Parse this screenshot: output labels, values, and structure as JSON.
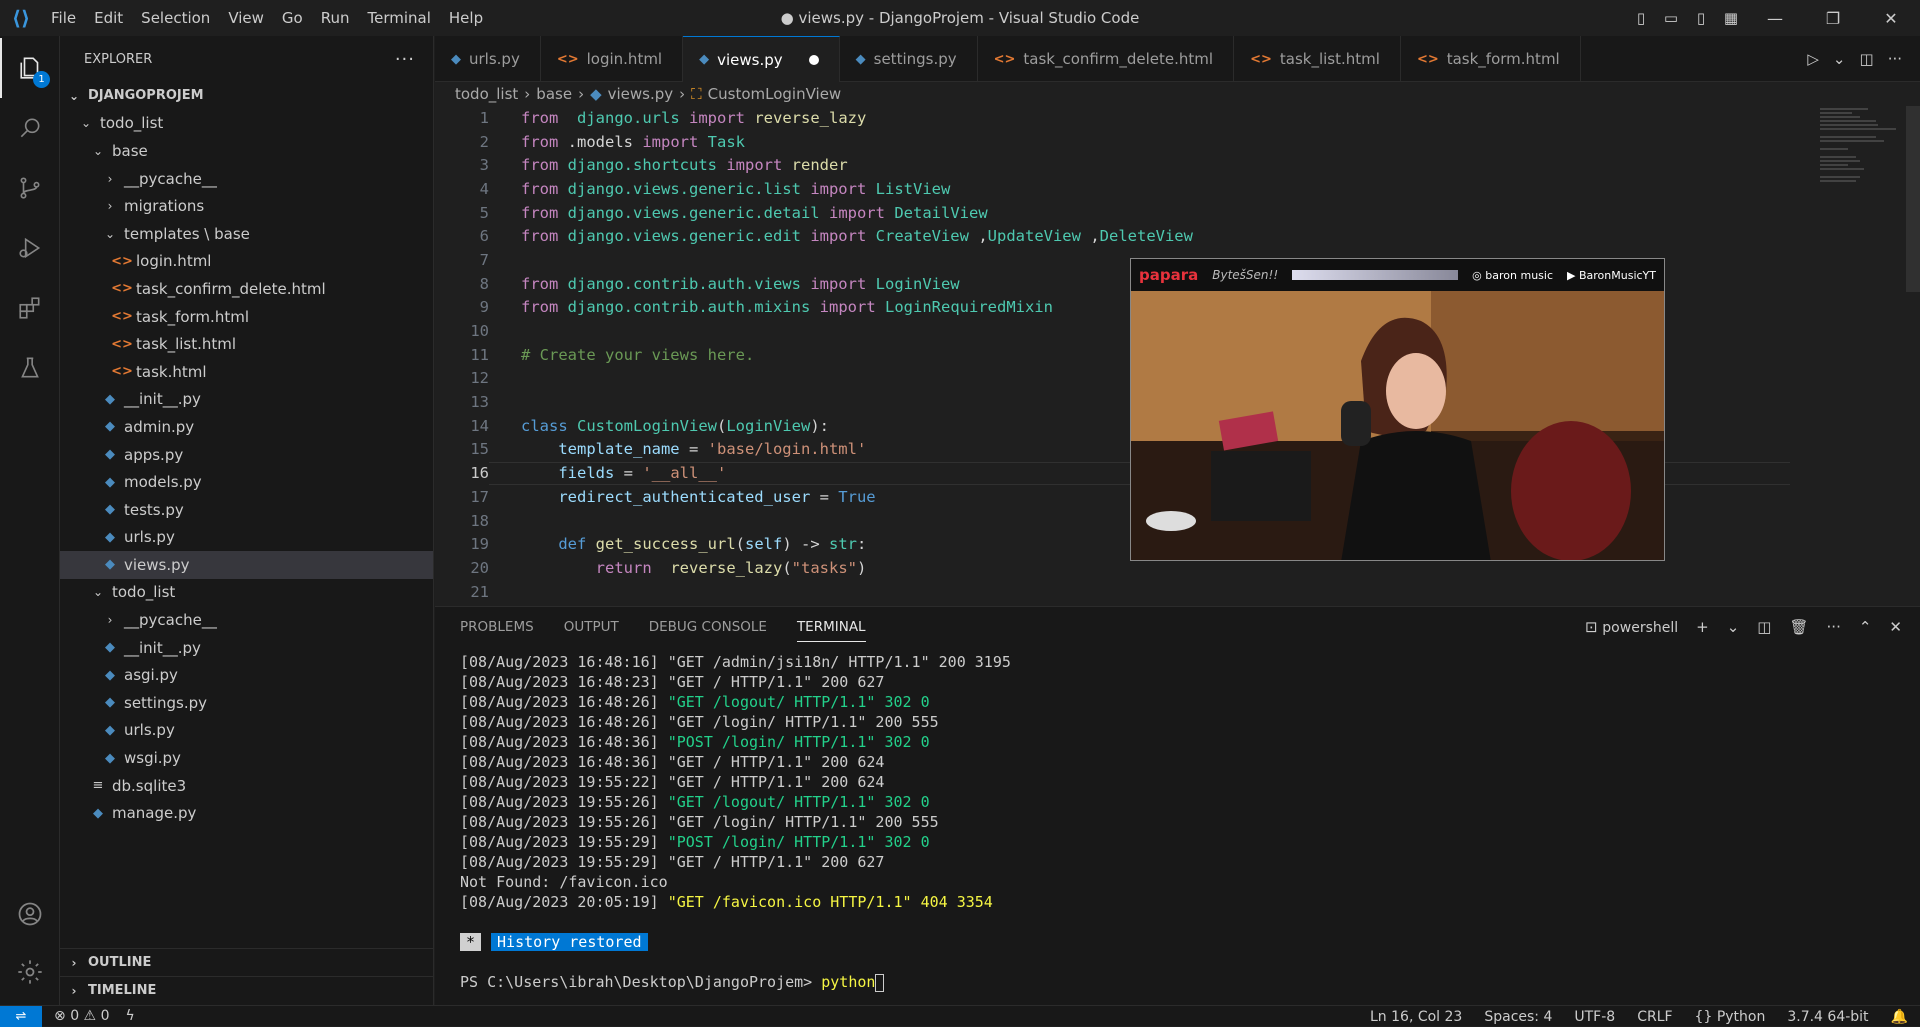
{
  "menu": {
    "items": [
      "File",
      "Edit",
      "Selection",
      "View",
      "Go",
      "Run",
      "Terminal",
      "Help"
    ]
  },
  "window": {
    "title": "● views.py - DjangoProjem - Visual Studio Code"
  },
  "activity": {
    "explorer_badge": "1"
  },
  "explorer": {
    "header": "EXPLORER",
    "root": "DJANGOPROJEM",
    "tree": [
      {
        "label": "todo_list",
        "type": "folder",
        "open": true,
        "depth": 1
      },
      {
        "label": "base",
        "type": "folder",
        "open": true,
        "depth": 2
      },
      {
        "label": "__pycache__",
        "type": "folder",
        "open": false,
        "depth": 3
      },
      {
        "label": "migrations",
        "type": "folder",
        "open": false,
        "depth": 3
      },
      {
        "label": "templates \\ base",
        "type": "folder",
        "open": true,
        "depth": 3
      },
      {
        "label": "login.html",
        "type": "html",
        "depth": 4
      },
      {
        "label": "task_confirm_delete.html",
        "type": "html",
        "depth": 4
      },
      {
        "label": "task_form.html",
        "type": "html",
        "depth": 4
      },
      {
        "label": "task_list.html",
        "type": "html",
        "depth": 4
      },
      {
        "label": "task.html",
        "type": "html",
        "depth": 4
      },
      {
        "label": "__init__.py",
        "type": "py",
        "depth": 3
      },
      {
        "label": "admin.py",
        "type": "py",
        "depth": 3
      },
      {
        "label": "apps.py",
        "type": "py",
        "depth": 3
      },
      {
        "label": "models.py",
        "type": "py",
        "depth": 3
      },
      {
        "label": "tests.py",
        "type": "py",
        "depth": 3
      },
      {
        "label": "urls.py",
        "type": "py",
        "depth": 3
      },
      {
        "label": "views.py",
        "type": "py",
        "depth": 3,
        "selected": true
      },
      {
        "label": "todo_list",
        "type": "folder",
        "open": true,
        "depth": 2
      },
      {
        "label": "__pycache__",
        "type": "folder",
        "open": false,
        "depth": 3
      },
      {
        "label": "__init__.py",
        "type": "py",
        "depth": 3
      },
      {
        "label": "asgi.py",
        "type": "py",
        "depth": 3
      },
      {
        "label": "settings.py",
        "type": "py",
        "depth": 3
      },
      {
        "label": "urls.py",
        "type": "py",
        "depth": 3
      },
      {
        "label": "wsgi.py",
        "type": "py",
        "depth": 3
      },
      {
        "label": "db.sqlite3",
        "type": "db",
        "depth": 2
      },
      {
        "label": "manage.py",
        "type": "py",
        "depth": 2
      }
    ],
    "outline": "OUTLINE",
    "timeline": "TIMELINE"
  },
  "tabs": [
    {
      "label": "urls.py",
      "type": "py"
    },
    {
      "label": "login.html",
      "type": "html"
    },
    {
      "label": "views.py",
      "type": "py",
      "active": true,
      "modified": true
    },
    {
      "label": "settings.py",
      "type": "py"
    },
    {
      "label": "task_confirm_delete.html",
      "type": "html"
    },
    {
      "label": "task_list.html",
      "type": "html"
    },
    {
      "label": "task_form.html",
      "type": "html"
    }
  ],
  "breadcrumb": {
    "items": [
      "todo_list",
      "base",
      "views.py",
      "CustomLoginView"
    ]
  },
  "editor": {
    "current_line": 16,
    "lines": [
      [
        [
          "k",
          "from"
        ],
        [
          "",
          "  "
        ],
        [
          "m",
          "django.urls"
        ],
        [
          "",
          " "
        ],
        [
          "k",
          "import"
        ],
        [
          "",
          " "
        ],
        [
          "f",
          "reverse_lazy"
        ]
      ],
      [
        [
          "k",
          "from"
        ],
        [
          "",
          " .models "
        ],
        [
          "k",
          "import"
        ],
        [
          "",
          " "
        ],
        [
          "t",
          "Task"
        ]
      ],
      [
        [
          "k",
          "from"
        ],
        [
          "",
          " "
        ],
        [
          "m",
          "django.shortcuts"
        ],
        [
          "",
          " "
        ],
        [
          "k",
          "import"
        ],
        [
          "",
          " "
        ],
        [
          "f",
          "render"
        ]
      ],
      [
        [
          "k",
          "from"
        ],
        [
          "",
          " "
        ],
        [
          "m",
          "django.views.generic.list"
        ],
        [
          "",
          " "
        ],
        [
          "k",
          "import"
        ],
        [
          "",
          " "
        ],
        [
          "t",
          "ListView"
        ]
      ],
      [
        [
          "k",
          "from"
        ],
        [
          "",
          " "
        ],
        [
          "m",
          "django.views.generic.detail"
        ],
        [
          "",
          " "
        ],
        [
          "k",
          "import"
        ],
        [
          "",
          " "
        ],
        [
          "t",
          "DetailView"
        ]
      ],
      [
        [
          "k",
          "from"
        ],
        [
          "",
          " "
        ],
        [
          "m",
          "django.views.generic.edit"
        ],
        [
          "",
          " "
        ],
        [
          "k",
          "import"
        ],
        [
          "",
          " "
        ],
        [
          "t",
          "CreateView"
        ],
        [
          "",
          " ,"
        ],
        [
          "t",
          "UpdateView"
        ],
        [
          "",
          " ,"
        ],
        [
          "t",
          "DeleteView"
        ]
      ],
      [],
      [
        [
          "k",
          "from"
        ],
        [
          "",
          " "
        ],
        [
          "m",
          "django.contrib.auth.views"
        ],
        [
          "",
          " "
        ],
        [
          "k",
          "import"
        ],
        [
          "",
          " "
        ],
        [
          "t",
          "LoginView"
        ]
      ],
      [
        [
          "k",
          "from"
        ],
        [
          "",
          " "
        ],
        [
          "m",
          "django.contrib.auth.mixins"
        ],
        [
          "",
          " "
        ],
        [
          "k",
          "import"
        ],
        [
          "",
          " "
        ],
        [
          "t",
          "LoginRequiredMixin"
        ]
      ],
      [],
      [
        [
          "c",
          "# Create your views here."
        ]
      ],
      [],
      [],
      [
        [
          "b",
          "class"
        ],
        [
          "",
          " "
        ],
        [
          "t",
          "CustomLoginView"
        ],
        [
          "",
          "("
        ],
        [
          "t",
          "LoginView"
        ],
        [
          "",
          "):"
        ]
      ],
      [
        [
          "",
          "    "
        ],
        [
          "v",
          "template_name"
        ],
        [
          "",
          " = "
        ],
        [
          "s",
          "'base/login.html'"
        ]
      ],
      [
        [
          "",
          "    "
        ],
        [
          "v",
          "fields"
        ],
        [
          "",
          " = "
        ],
        [
          "s",
          "'__all__'"
        ]
      ],
      [
        [
          "",
          "    "
        ],
        [
          "v",
          "redirect_authenticated_user"
        ],
        [
          "",
          " = "
        ],
        [
          "b",
          "True"
        ]
      ],
      [],
      [
        [
          "",
          "    "
        ],
        [
          "b",
          "def"
        ],
        [
          "",
          " "
        ],
        [
          "f",
          "get_success_url"
        ],
        [
          "",
          "("
        ],
        [
          "v",
          "self"
        ],
        [
          "",
          ") -> "
        ],
        [
          "t",
          "str"
        ],
        [
          "",
          ":"
        ]
      ],
      [
        [
          "",
          "        "
        ],
        [
          "k",
          "return"
        ],
        [
          "",
          "  "
        ],
        [
          "f",
          "reverse_lazy"
        ],
        [
          "",
          "("
        ],
        [
          "s",
          "\"tasks\""
        ],
        [
          "",
          ")"
        ]
      ],
      []
    ]
  },
  "overlay": {
    "brand": "papara",
    "sub": "BytešSen!!",
    "handle1": "baron music",
    "handle2": "BaronMusicYT"
  },
  "panel": {
    "tabs": [
      "PROBLEMS",
      "OUTPUT",
      "DEBUG CONSOLE",
      "TERMINAL"
    ],
    "active_tab": "TERMINAL",
    "shell": "powershell",
    "lines": [
      {
        "ts": "[08/Aug/2023 16:48:16] ",
        "msg": "\"GET /admin/jsi18n/ HTTP/1.1\" 200 3195",
        "color": ""
      },
      {
        "ts": "[08/Aug/2023 16:48:23] ",
        "msg": "\"GET / HTTP/1.1\" 200 627",
        "color": ""
      },
      {
        "ts": "[08/Aug/2023 16:48:26] ",
        "msg": "\"GET /logout/ HTTP/1.1\" 302 0",
        "color": "g"
      },
      {
        "ts": "[08/Aug/2023 16:48:26] ",
        "msg": "\"GET /login/ HTTP/1.1\" 200 555",
        "color": ""
      },
      {
        "ts": "[08/Aug/2023 16:48:36] ",
        "msg": "\"POST /login/ HTTP/1.1\" 302 0",
        "color": "g"
      },
      {
        "ts": "[08/Aug/2023 16:48:36] ",
        "msg": "\"GET / HTTP/1.1\" 200 624",
        "color": ""
      },
      {
        "ts": "[08/Aug/2023 19:55:22] ",
        "msg": "\"GET / HTTP/1.1\" 200 624",
        "color": ""
      },
      {
        "ts": "[08/Aug/2023 19:55:26] ",
        "msg": "\"GET /logout/ HTTP/1.1\" 302 0",
        "color": "g"
      },
      {
        "ts": "[08/Aug/2023 19:55:26] ",
        "msg": "\"GET /login/ HTTP/1.1\" 200 555",
        "color": ""
      },
      {
        "ts": "[08/Aug/2023 19:55:29] ",
        "msg": "\"POST /login/ HTTP/1.1\" 302 0",
        "color": "g"
      },
      {
        "ts": "[08/Aug/2023 19:55:29] ",
        "msg": "\"GET / HTTP/1.1\" 200 627",
        "color": ""
      },
      {
        "ts": "Not Found: /favicon.ico",
        "msg": "",
        "color": ""
      },
      {
        "ts": "[08/Aug/2023 20:05:19] ",
        "msg": "\"GET /favicon.ico HTTP/1.1\" 404 3354",
        "color": "y"
      }
    ],
    "restored_star": "*",
    "restored": "History restored",
    "prompt": "PS C:\\Users\\ibrah\\Desktop\\DjangoProjem> ",
    "command": "python"
  },
  "status": {
    "errors": "0",
    "warnings": "0",
    "position": "Ln 16, Col 23",
    "spaces": "Spaces: 4",
    "encoding": "UTF-8",
    "eol": "CRLF",
    "language": "Python",
    "interpreter": "3.7.4 64-bit"
  }
}
